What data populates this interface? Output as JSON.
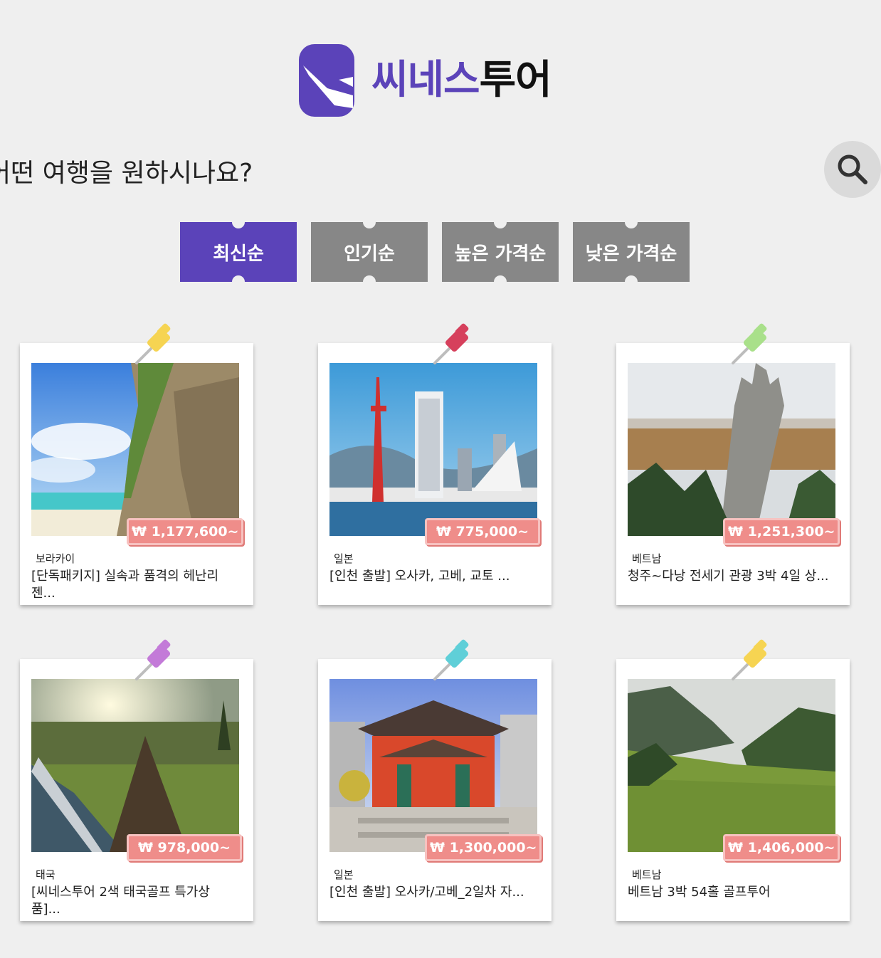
{
  "brand": {
    "name_accent": "씨네스",
    "name_dark": "투어",
    "accent_color": "#5b43b9"
  },
  "search": {
    "prompt": "어떤 여행을 원하시나요?",
    "icon": "search-icon"
  },
  "sort_tabs": [
    {
      "label": "최신순",
      "active": true
    },
    {
      "label": "인기순",
      "active": false
    },
    {
      "label": "높은 가격순",
      "active": false
    },
    {
      "label": "낮은 가격순",
      "active": false
    }
  ],
  "products": [
    {
      "region": "보라카이",
      "title": "[단독패키지] 실속과 품격의 헤난리 젠...",
      "price": "₩ 1,177,600~",
      "pin_color": "#f6d452",
      "image": "beach-cliff"
    },
    {
      "region": "일본",
      "title": "[인천 출발] 오사카, 고베, 교토 ...",
      "price": "₩ 775,000~",
      "pin_color": "#d6405c",
      "image": "kobe-port-tower"
    },
    {
      "region": "베트남",
      "title": "청주~다낭 전세기 관광 3박 4일 상...",
      "price": "₩ 1,251,300~",
      "pin_color": "#a9e08a",
      "image": "golden-bridge-hands"
    },
    {
      "region": "태국",
      "title": "[씨네스투어 2색 태국골프 특가상 품]...",
      "price": "₩ 978,000~",
      "pin_color": "#c37ad8",
      "image": "golf-resort-sunset"
    },
    {
      "region": "일본",
      "title": "[인천 출발] 오사카/고베_2일차 자...",
      "price": "₩ 1,300,000~",
      "pin_color": "#5fcfd8",
      "image": "ikuta-shrine"
    },
    {
      "region": "베트남",
      "title": "베트남 3박 54홀 골프투어",
      "price": "₩ 1,406,000~",
      "pin_color": "#f6d452",
      "image": "golf-course-mountains"
    }
  ]
}
